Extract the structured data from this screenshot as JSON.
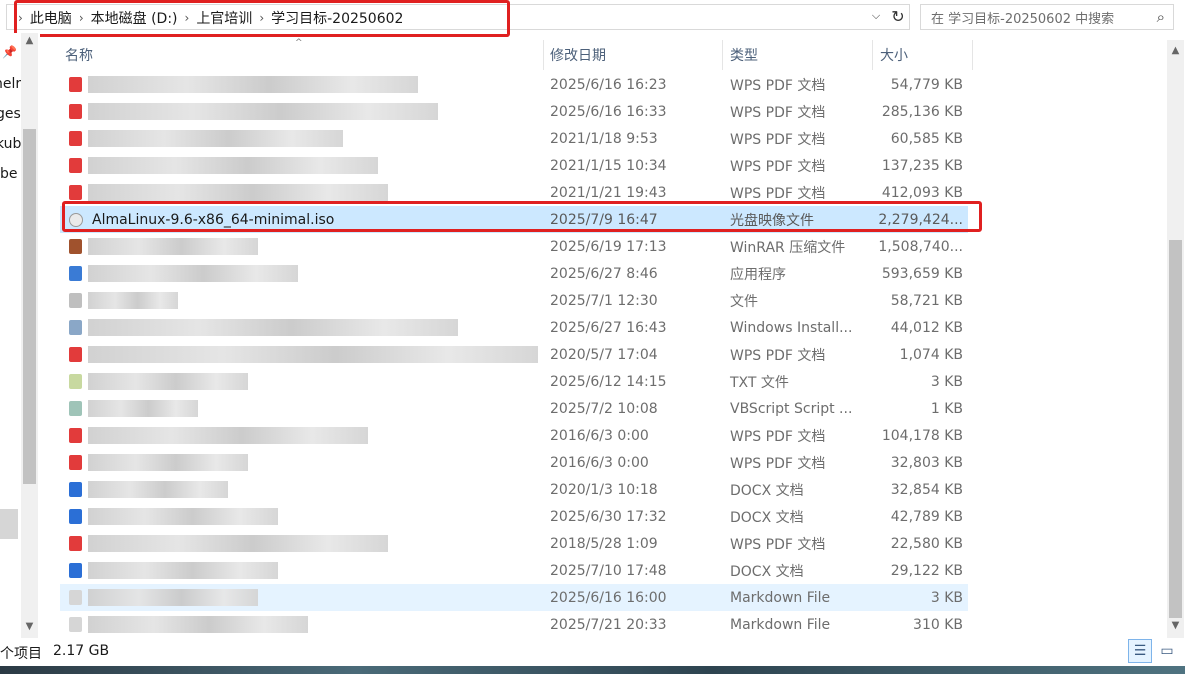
{
  "address_bar": {
    "crumbs": [
      "此电脑",
      "本地磁盘 (D:)",
      "上官培训",
      "学习目标-20250602"
    ]
  },
  "search": {
    "placeholder": "在 学习目标-20250602 中搜索"
  },
  "left_pane": {
    "items": [
      "nelr",
      "ges",
      "kub",
      "be"
    ]
  },
  "columns": {
    "name": "名称",
    "date": "修改日期",
    "type": "类型",
    "size": "大小"
  },
  "files": [
    {
      "name": "",
      "date": "2025/6/16 16:23",
      "type": "WPS PDF 文档",
      "size": "54,779 KB",
      "icon": "pdf-icon"
    },
    {
      "name": "",
      "date": "2025/6/16 16:33",
      "type": "WPS PDF 文档",
      "size": "285,136 KB",
      "icon": "pdf-icon"
    },
    {
      "name": "",
      "date": "2021/1/18 9:53",
      "type": "WPS PDF 文档",
      "size": "60,585 KB",
      "icon": "pdf-icon"
    },
    {
      "name": "",
      "date": "2021/1/15 10:34",
      "type": "WPS PDF 文档",
      "size": "137,235 KB",
      "icon": "pdf-icon"
    },
    {
      "name": "",
      "date": "2021/1/21 19:43",
      "type": "WPS PDF 文档",
      "size": "412,093 KB",
      "icon": "pdf-icon"
    },
    {
      "name": "AlmaLinux-9.6-x86_64-minimal.iso",
      "date": "2025/7/9 16:47",
      "type": "光盘映像文件",
      "size": "2,279,424...",
      "icon": "disc-image-icon",
      "selected": true
    },
    {
      "name": "",
      "date": "2025/6/19 17:13",
      "type": "WinRAR 压缩文件",
      "size": "1,508,740...",
      "icon": "archive-icon"
    },
    {
      "name": "",
      "date": "2025/6/27 8:46",
      "type": "应用程序",
      "size": "593,659 KB",
      "icon": "application-icon"
    },
    {
      "name": "",
      "date": "2025/7/1 12:30",
      "type": "文件",
      "size": "58,721 KB",
      "icon": "file-icon"
    },
    {
      "name": "",
      "date": "2025/6/27 16:43",
      "type": "Windows Install...",
      "size": "44,012 KB",
      "icon": "installer-icon"
    },
    {
      "name": "",
      "date": "2020/5/7 17:04",
      "type": "WPS PDF 文档",
      "size": "1,074 KB",
      "icon": "pdf-icon"
    },
    {
      "name": "",
      "date": "2025/6/12 14:15",
      "type": "TXT 文件",
      "size": "3 KB",
      "icon": "text-file-icon"
    },
    {
      "name": "",
      "date": "2025/7/2 10:08",
      "type": "VBScript Script ...",
      "size": "1 KB",
      "icon": "script-icon"
    },
    {
      "name": "",
      "date": "2016/6/3 0:00",
      "type": "WPS PDF 文档",
      "size": "104,178 KB",
      "icon": "pdf-icon"
    },
    {
      "name": "",
      "date": "2016/6/3 0:00",
      "type": "WPS PDF 文档",
      "size": "32,803 KB",
      "icon": "pdf-icon"
    },
    {
      "name": "",
      "date": "2020/1/3 10:18",
      "type": "DOCX 文档",
      "size": "32,854 KB",
      "icon": "docx-icon"
    },
    {
      "name": "",
      "date": "2025/6/30 17:32",
      "type": "DOCX 文档",
      "size": "42,789 KB",
      "icon": "docx-icon"
    },
    {
      "name": "",
      "date": "2018/5/28 1:09",
      "type": "WPS PDF 文档",
      "size": "22,580 KB",
      "icon": "pdf-icon"
    },
    {
      "name": "",
      "date": "2025/7/10 17:48",
      "type": "DOCX 文档",
      "size": "29,122 KB",
      "icon": "docx-icon"
    },
    {
      "name": "",
      "date": "2025/6/16 16:00",
      "type": "Markdown File",
      "size": "3 KB",
      "icon": "markdown-icon",
      "hover": true
    },
    {
      "name": "",
      "date": "2025/7/21 20:33",
      "type": "Markdown File",
      "size": "310 KB",
      "icon": "markdown-icon"
    }
  ],
  "status_bar": {
    "count_text": "个项目",
    "size_text": "2.17 GB"
  }
}
